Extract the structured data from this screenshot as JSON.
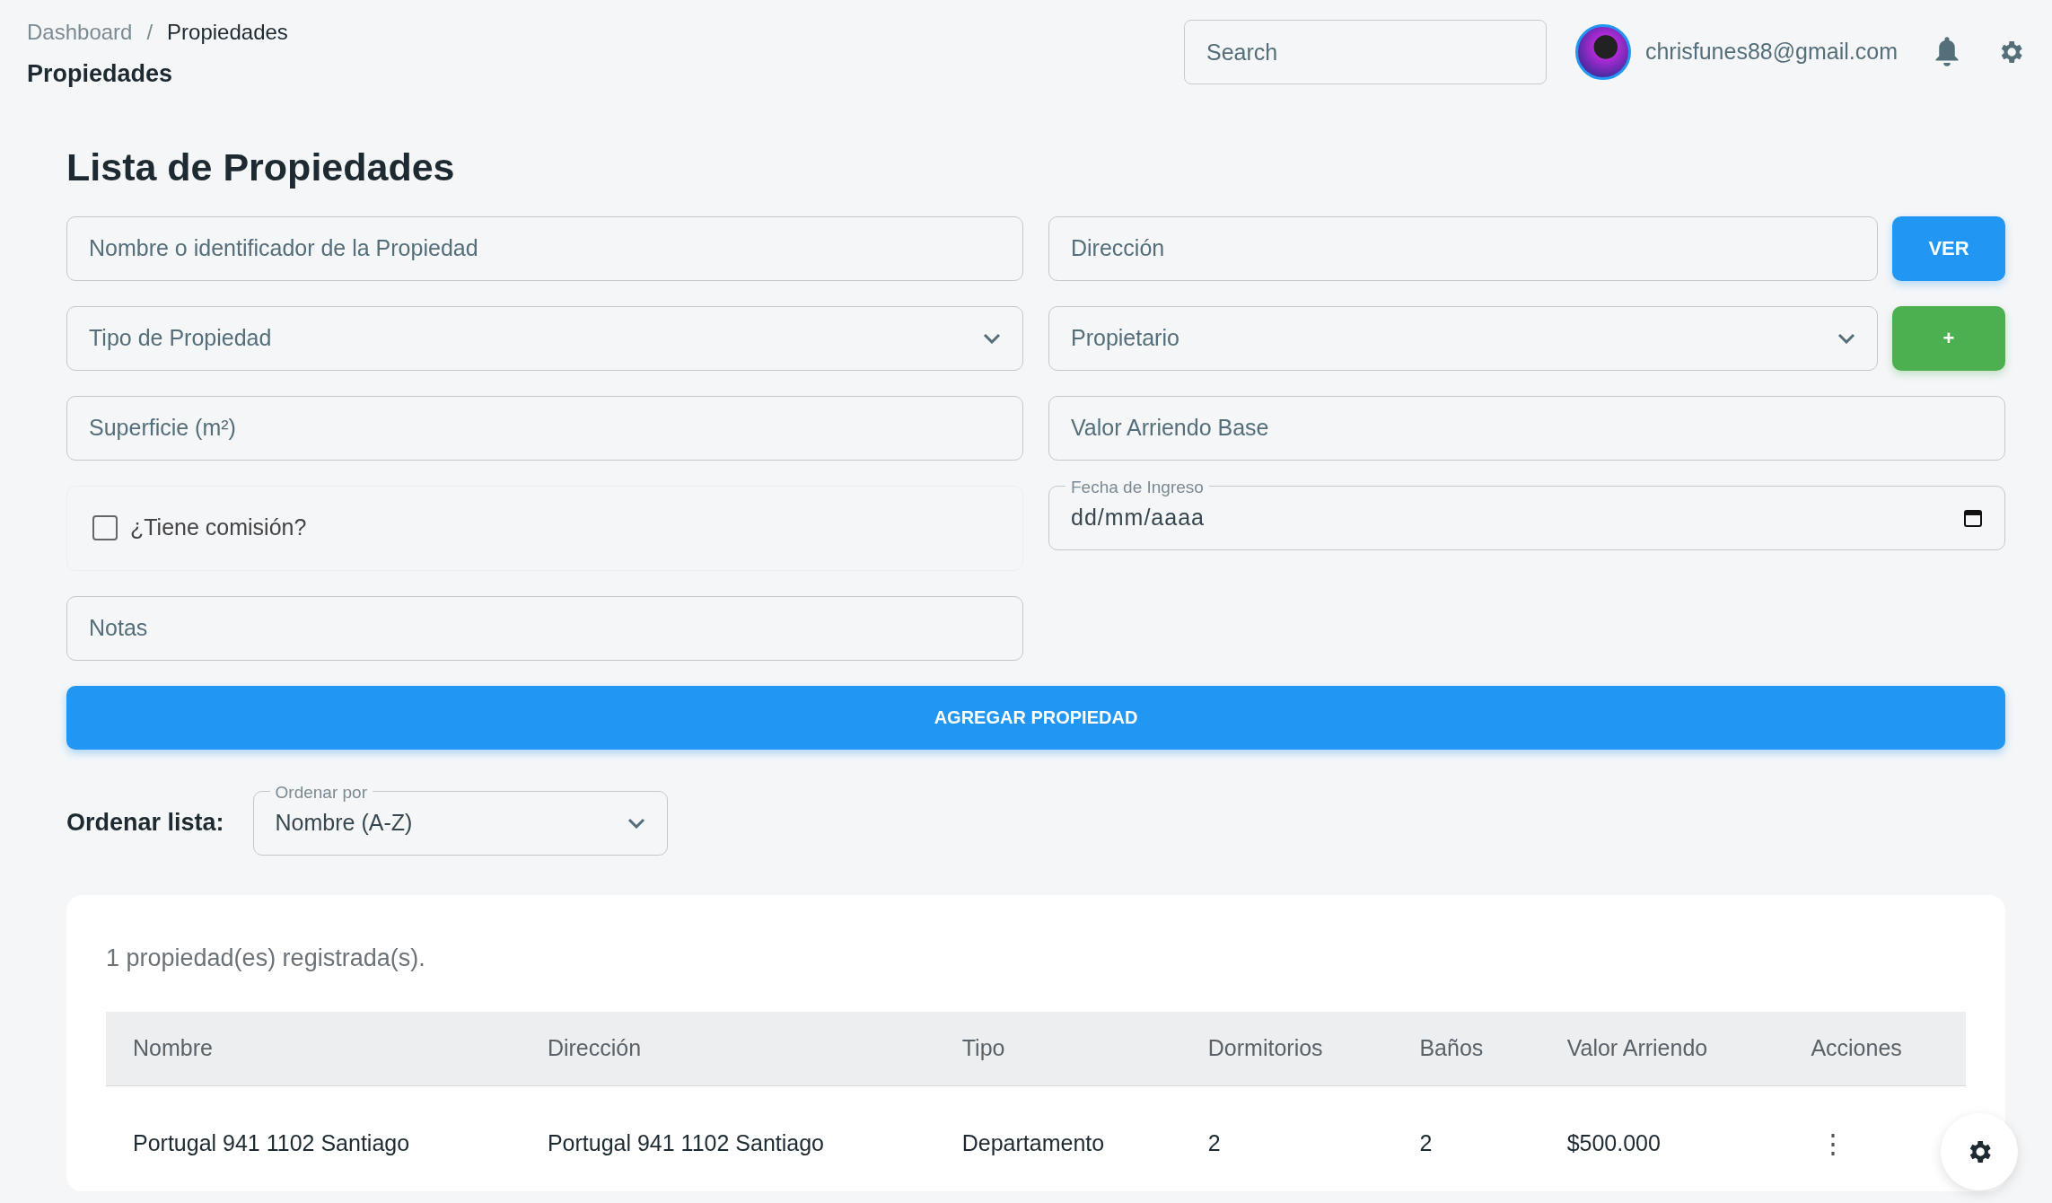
{
  "breadcrumb": [
    {
      "label": "Dashboard",
      "current": false
    },
    {
      "label": "Propiedades",
      "current": true
    }
  ],
  "breadcrumb_separator": "/",
  "page_title": "Propiedades",
  "header": {
    "search": {
      "placeholder": "Search"
    },
    "user_email": "chrisfunes88@gmail.com"
  },
  "heading": "Lista de Propiedades",
  "form": {
    "name_field": {
      "placeholder": "Nombre o identificador de la Propiedad"
    },
    "address_field": {
      "placeholder": "Dirección"
    },
    "view_button": "VER",
    "type_select": {
      "placeholder": "Tipo de Propiedad"
    },
    "owner_select": {
      "placeholder": "Propietario"
    },
    "add_owner_button": "+",
    "area_field": {
      "placeholder": "Superficie (m²)"
    },
    "rent_field": {
      "placeholder": "Valor Arriendo Base"
    },
    "commission": {
      "label": "¿Tiene comisión?",
      "checked": false
    },
    "date_field": {
      "label": "Fecha de Ingreso",
      "value": "dd/mm/aaaa"
    },
    "notes_field": {
      "placeholder": "Notas"
    },
    "submit_button": "AGREGAR PROPIEDAD"
  },
  "sort": {
    "label": "Ordenar lista:",
    "field_label": "Ordenar por",
    "value": "Nombre (A-Z)"
  },
  "table": {
    "count_text": "1 propiedad(es) registrada(s).",
    "columns": [
      "Nombre",
      "Dirección",
      "Tipo",
      "Dormitorios",
      "Baños",
      "Valor Arriendo",
      "Acciones"
    ],
    "rows": [
      {
        "cells": [
          "Portugal 941 1102 Santiago",
          "Portugal 941 1102 Santiago",
          "Departamento",
          "2",
          "2",
          "$500.000"
        ],
        "actions": "⋮"
      }
    ]
  }
}
